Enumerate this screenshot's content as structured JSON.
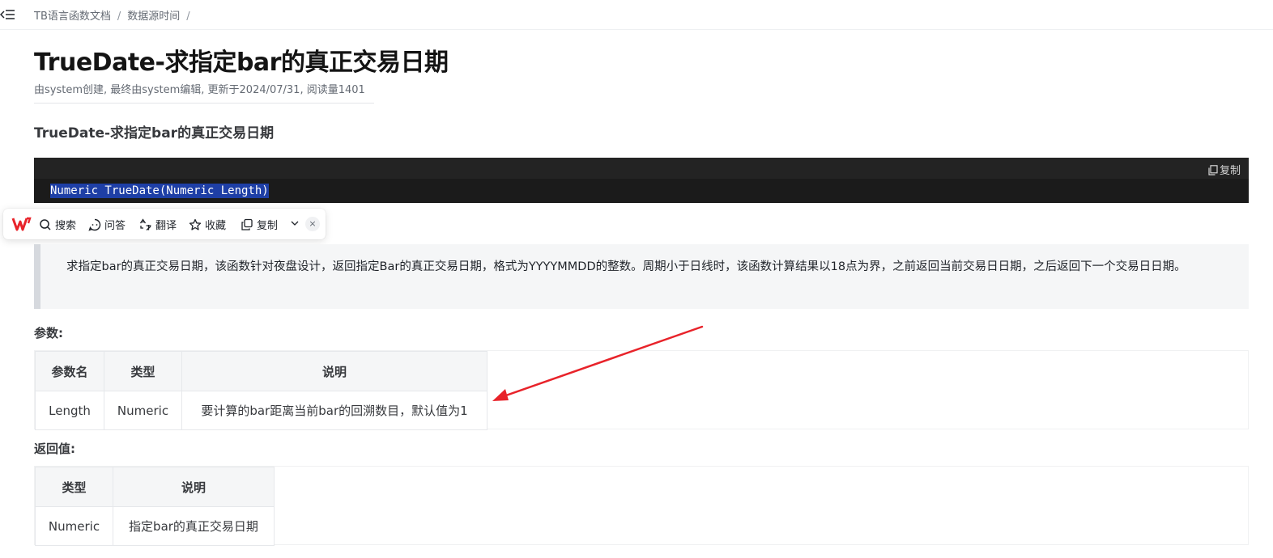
{
  "breadcrumb": {
    "items": [
      "TB语言函数文档",
      "数据源时间"
    ],
    "separator": "/"
  },
  "title": "TrueDate-求指定bar的真正交易日期",
  "meta": "由system创建, 最终由system编辑, 更新于2024/07/31, 阅读量1401",
  "subtitle": "TrueDate-求指定bar的真正交易日期",
  "code": {
    "copy_label": "复制",
    "line": "Numeric TrueDate(Numeric Length)"
  },
  "float_toolbar": {
    "search": "搜索",
    "qa": "问答",
    "translate": "翻译",
    "favorite": "收藏",
    "copy": "复制",
    "close": "×"
  },
  "description": "求指定bar的真正交易日期，该函数针对夜盘设计，返回指定Bar的真正交易日期，格式为YYYYMMDD的整数。周期小于日线时，该函数计算结果以18点为界，之前返回当前交易日日期，之后返回下一个交易日日期。",
  "params": {
    "label": "参数:",
    "headers": [
      "参数名",
      "类型",
      "说明"
    ],
    "rows": [
      [
        "Length",
        "Numeric",
        "要计算的bar距离当前bar的回溯数目，默认值为1"
      ]
    ]
  },
  "returns": {
    "label": "返回值:",
    "headers": [
      "类型",
      "说明"
    ],
    "rows": [
      [
        "Numeric",
        "指定bar的真正交易日期"
      ]
    ]
  },
  "colors": {
    "code_bg": "#1b1b1b",
    "code_highlight": "#1e3fa6",
    "annotation_arrow": "#e8232a",
    "wps_logo": "#e8232a"
  },
  "icons": [
    "menu-collapse-icon",
    "copy-icon",
    "wps-logo-icon",
    "search-icon",
    "qa-icon",
    "translate-icon",
    "star-icon",
    "copy-icon",
    "chevron-down-icon",
    "close-icon"
  ]
}
